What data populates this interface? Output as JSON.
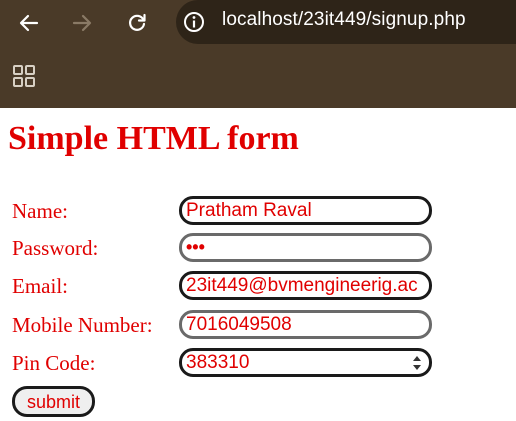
{
  "browser": {
    "url": "localhost/23it449/signup.php"
  },
  "page": {
    "title": "Simple HTML form"
  },
  "form": {
    "fields": [
      {
        "label": "Name:",
        "value": "Pratham Raval"
      },
      {
        "label": "Password:",
        "value": "•••"
      },
      {
        "label": "Email:",
        "value": "23it449@bvmengineerig.ac"
      },
      {
        "label": "Mobile Number:",
        "value": "7016049508"
      },
      {
        "label": "Pin Code:",
        "value": "383310"
      }
    ],
    "submit_label": "submit"
  },
  "colors": {
    "text": "#e00000",
    "chrome": "#4a3a28",
    "address_bar": "#2e2418"
  },
  "icons": [
    "back-icon",
    "forward-icon",
    "reload-icon",
    "site-info-icon",
    "apps-icon",
    "spinner-icon"
  ]
}
